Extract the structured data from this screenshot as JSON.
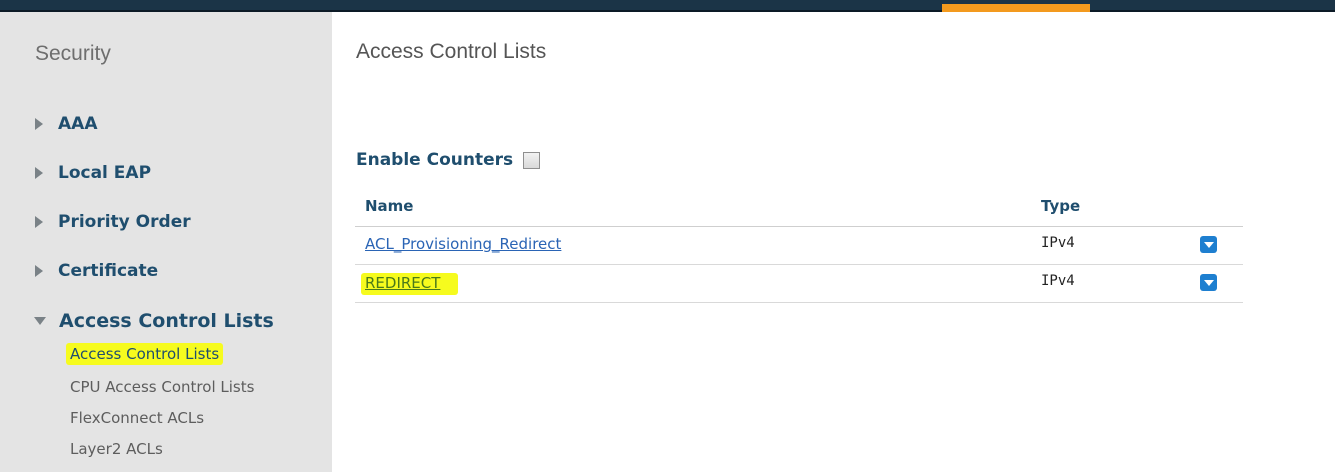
{
  "sidebar": {
    "title": "Security",
    "items": [
      {
        "label": "AAA",
        "expanded": false
      },
      {
        "label": "Local EAP",
        "expanded": false
      },
      {
        "label": "Priority Order",
        "expanded": false
      },
      {
        "label": "Certificate",
        "expanded": false
      },
      {
        "label": "Access Control Lists",
        "expanded": true
      }
    ],
    "subitems": [
      {
        "label": "Access Control Lists",
        "active": true
      },
      {
        "label": "CPU Access Control Lists",
        "active": false
      },
      {
        "label": "FlexConnect ACLs",
        "active": false
      },
      {
        "label": "Layer2 ACLs",
        "active": false
      }
    ]
  },
  "main": {
    "title": "Access Control Lists",
    "enable_counters_label": "Enable Counters",
    "enable_counters_checked": false,
    "table": {
      "columns": [
        "Name",
        "Type"
      ],
      "rows": [
        {
          "name": "ACL_Provisioning_Redirect",
          "type": "IPv4"
        },
        {
          "name": "REDIRECT",
          "type": "IPv4"
        }
      ]
    }
  },
  "colors": {
    "topbar": "#1b3447",
    "accent": "#f39a1e",
    "highlight": "#f6fb1e",
    "link": "#2a64b5",
    "heading": "#1f4e6e"
  }
}
